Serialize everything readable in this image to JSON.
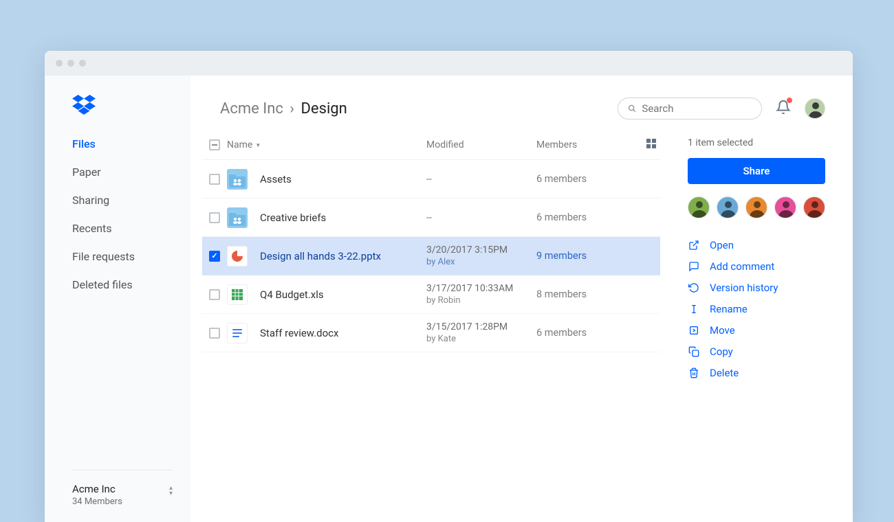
{
  "sidebar": {
    "nav": [
      {
        "label": "Files",
        "active": true
      },
      {
        "label": "Paper",
        "active": false
      },
      {
        "label": "Sharing",
        "active": false
      },
      {
        "label": "Recents",
        "active": false
      },
      {
        "label": "File requests",
        "active": false
      },
      {
        "label": "Deleted files",
        "active": false
      }
    ],
    "team_name": "Acme Inc",
    "team_members": "34 Members"
  },
  "header": {
    "crumb_root": "Acme Inc",
    "crumb_sep": "›",
    "crumb_current": "Design",
    "search_placeholder": "Search"
  },
  "columns": {
    "name": "Name",
    "modified": "Modified",
    "members": "Members"
  },
  "files": [
    {
      "selected": false,
      "icon": "folder",
      "name": "Assets",
      "modified": "--",
      "by": "",
      "members": "6 members"
    },
    {
      "selected": false,
      "icon": "folder",
      "name": "Creative briefs",
      "modified": "--",
      "by": "",
      "members": "6 members"
    },
    {
      "selected": true,
      "icon": "ppt",
      "name": "Design all hands 3-22.pptx",
      "modified": "3/20/2017 3:15PM",
      "by": "by Alex",
      "members": "9 members"
    },
    {
      "selected": false,
      "icon": "xls",
      "name": "Q4 Budget.xls",
      "modified": "3/17/2017 10:33AM",
      "by": "by Robin",
      "members": "8 members"
    },
    {
      "selected": false,
      "icon": "doc",
      "name": "Staff review.docx",
      "modified": "3/15/2017 1:28PM",
      "by": "by Kate",
      "members": "6 members"
    }
  ],
  "panel": {
    "selection": "1 item selected",
    "share_label": "Share",
    "avatar_colors": [
      "#7fae4c",
      "#6aa9d6",
      "#e8892f",
      "#e84f9a",
      "#d94f3a"
    ],
    "actions": [
      {
        "icon": "open",
        "label": "Open"
      },
      {
        "icon": "comment",
        "label": "Add comment"
      },
      {
        "icon": "history",
        "label": "Version history"
      },
      {
        "icon": "rename",
        "label": "Rename"
      },
      {
        "icon": "move",
        "label": "Move"
      },
      {
        "icon": "copy",
        "label": "Copy"
      },
      {
        "icon": "delete",
        "label": "Delete"
      }
    ]
  }
}
